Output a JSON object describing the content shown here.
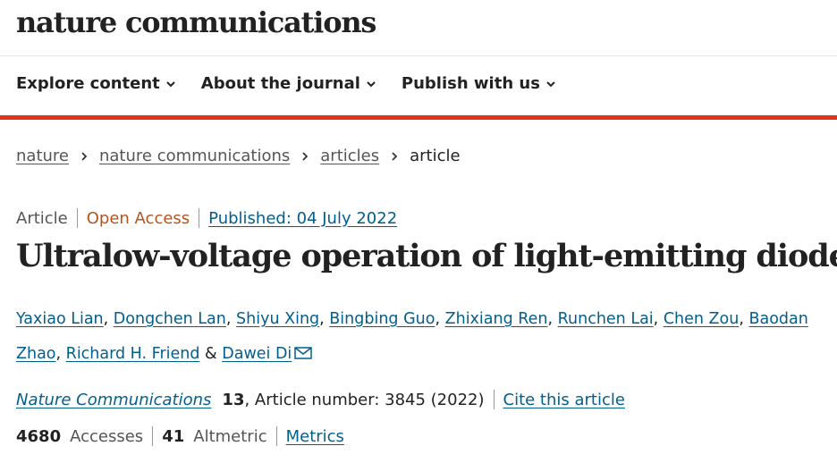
{
  "header": {
    "logo": "nature communications"
  },
  "nav": {
    "items": [
      {
        "label": "Explore content",
        "icon": "chevron-down-icon"
      },
      {
        "label": "About the journal",
        "icon": "chevron-down-icon"
      },
      {
        "label": "Publish with us",
        "icon": "chevron-down-icon"
      }
    ]
  },
  "breadcrumb": {
    "items": [
      "nature",
      "nature communications",
      "articles"
    ],
    "current": "article",
    "separator_icon": "chevron-right-icon"
  },
  "article": {
    "type": "Article",
    "access": "Open Access",
    "published": "Published: 04 July 2022",
    "title": "Ultralow-voltage operation of light-emitting diodes",
    "authors": [
      "Yaxiao Lian",
      "Dongchen Lan",
      "Shiyu Xing",
      "Bingbing Guo",
      "Zhixiang Ren",
      "Runchen Lai",
      "Chen Zou",
      "Baodan Zhao",
      "Richard H. Friend",
      "Dawei Di"
    ],
    "author_sep": ", ",
    "author_last_sep": " & ",
    "citation": {
      "journal": "Nature Communications",
      "volume": "13",
      "rest": ", Article number: 3845 (2022)",
      "cite_label": "Cite this article"
    },
    "metrics": {
      "accesses_value": "4680",
      "accesses_label": "Accesses",
      "altmetric_value": "41",
      "altmetric_label": "Altmetric",
      "metrics_link": "Metrics"
    }
  },
  "colors": {
    "accent_red": "#e0301e",
    "link_blue": "#025e8d",
    "open_access": "#b5541c",
    "text": "#222222"
  }
}
